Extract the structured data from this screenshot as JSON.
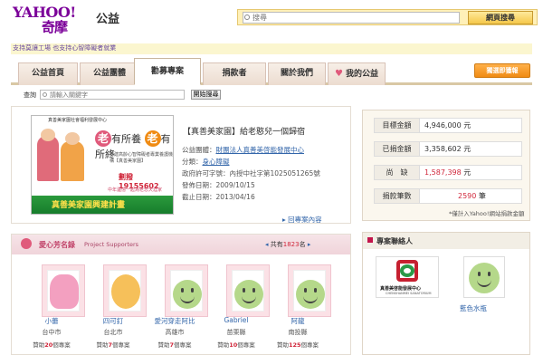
{
  "header": {
    "logo_text": "YAHOO!",
    "logo_cn": "奇摩",
    "section": "公益",
    "search_placeholder": "搜尋",
    "search_button": "網頁搜尋"
  },
  "notice": "支持莫讓工場 也支持心智障礙者就業",
  "nav": {
    "tabs": [
      "公益首頁",
      "公益團體",
      "勸募專案",
      "捐款者",
      "關於我們",
      "我的公益"
    ],
    "active": "勸募專案",
    "promo_button": "獨選即獲報"
  },
  "filter": {
    "label": "查詢",
    "placeholder": "請輸入關鍵字",
    "button": "開始搜尋"
  },
  "project": {
    "poster": {
      "header": "真善美家園社會福利發展中心",
      "big_text": [
        "老",
        "有所養",
        "老",
        "有所終"
      ],
      "sub_text": "營建高齡心智障礙者專業養護機構【真善美家園】",
      "phone": "劃撥19155602",
      "caption": "中年遺憶一起為老悲天涯家",
      "banner": "真善美家園興建計畫"
    },
    "title": "【真善美家園】給老憨兒一個歸宿",
    "info": {
      "org_label": "公益團體：",
      "org": "財團法人真善美啓能發展中心",
      "category_label": "分類：",
      "category": "身心障礙",
      "permit_label": "政府許可字號：",
      "permit": "內授中社字第1025051265號",
      "start_label": "發佈日期：",
      "start": "2009/10/15",
      "end_label": "截止日期：",
      "end": "2013/04/16"
    },
    "more_link": "回專案內容"
  },
  "summary": {
    "rows": [
      {
        "label": "目標金額",
        "value": "4,946,000",
        "unit": "元"
      },
      {
        "label": "已捐金額",
        "value": "3,358,602",
        "unit": "元"
      },
      {
        "label": "尚　缺",
        "value": "1,587,398",
        "unit": "元"
      },
      {
        "label": "捐款筆數",
        "value": "2590",
        "unit": "筆"
      }
    ],
    "note": "*僅計入Yahoo!網站捐款金額"
  },
  "supporters": {
    "title": "愛心芳名錄",
    "title_en": "Project Supporters",
    "pager_prefix": "共有",
    "count": "1823",
    "pager_suffix": "名",
    "items": [
      {
        "name": "小蕾",
        "city": "台中市",
        "don_prefix": "贊助",
        "count": "20",
        "don_suffix": "個專案"
      },
      {
        "name": "四可釘",
        "city": "台北市",
        "don_prefix": "贊助",
        "count": "7",
        "don_suffix": "個專案"
      },
      {
        "name": "愛河穿走阿比",
        "city": "高雄市",
        "don_prefix": "贊助",
        "count": "7",
        "don_suffix": "個專案"
      },
      {
        "name": "Gabriel",
        "city": "苗栗縣",
        "don_prefix": "贊助",
        "count": "10",
        "don_suffix": "個專案"
      },
      {
        "name": "阿龍",
        "city": "南投縣",
        "don_prefix": "贊助",
        "count": "125",
        "don_suffix": "個專案"
      }
    ]
  },
  "contact": {
    "title": "專案聯絡人",
    "org_logo_text": "真善美啓能發展中心",
    "org_logo_en": "CHENSHANMEI SANATORIUM",
    "person": "藍色水瓶"
  },
  "colors": {
    "brand_purple": "#7b0099",
    "accent_red": "#d0273b",
    "link_blue": "#3366aa"
  }
}
